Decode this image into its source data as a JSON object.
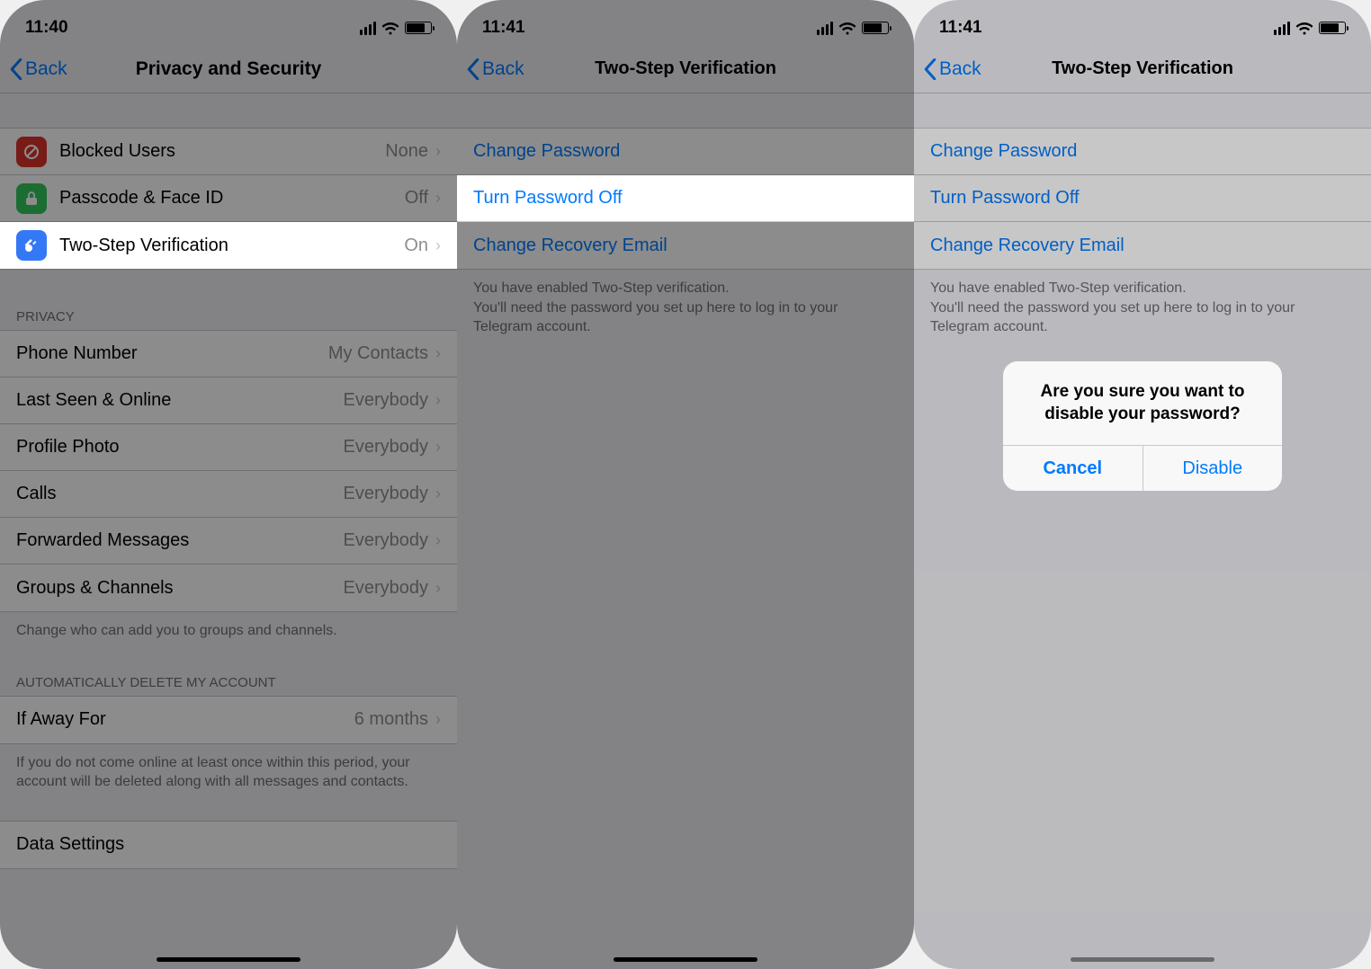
{
  "panel1": {
    "time": "11:40",
    "back": "Back",
    "title": "Privacy and Security",
    "security": [
      {
        "label": "Blocked Users",
        "value": "None"
      },
      {
        "label": "Passcode & Face ID",
        "value": "Off"
      },
      {
        "label": "Two-Step Verification",
        "value": "On"
      }
    ],
    "privacy_header": "PRIVACY",
    "privacy": [
      {
        "label": "Phone Number",
        "value": "My Contacts"
      },
      {
        "label": "Last Seen & Online",
        "value": "Everybody"
      },
      {
        "label": "Profile Photo",
        "value": "Everybody"
      },
      {
        "label": "Calls",
        "value": "Everybody"
      },
      {
        "label": "Forwarded Messages",
        "value": "Everybody"
      },
      {
        "label": "Groups & Channels",
        "value": "Everybody"
      }
    ],
    "privacy_footer": "Change who can add you to groups and channels.",
    "delete_header": "AUTOMATICALLY DELETE MY ACCOUNT",
    "delete_row": {
      "label": "If Away For",
      "value": "6 months"
    },
    "delete_footer": "If you do not come online at least once within this period, your account will be deleted along with all messages and contacts.",
    "data_settings": "Data Settings"
  },
  "panel2": {
    "time": "11:41",
    "back": "Back",
    "title": "Two-Step Verification",
    "rows": [
      "Change Password",
      "Turn Password Off",
      "Change Recovery Email"
    ],
    "footer": "You have enabled Two-Step verification.\nYou'll need the password you set up here to log in to your Telegram account."
  },
  "panel3": {
    "time": "11:41",
    "back": "Back",
    "title": "Two-Step Verification",
    "rows": [
      "Change Password",
      "Turn Password Off",
      "Change Recovery Email"
    ],
    "footer": "You have enabled Two-Step verification.\nYou'll need the password you set up here to log in to your Telegram account.",
    "alert": {
      "message": "Are you sure you want to disable your password?",
      "cancel": "Cancel",
      "confirm": "Disable"
    }
  }
}
